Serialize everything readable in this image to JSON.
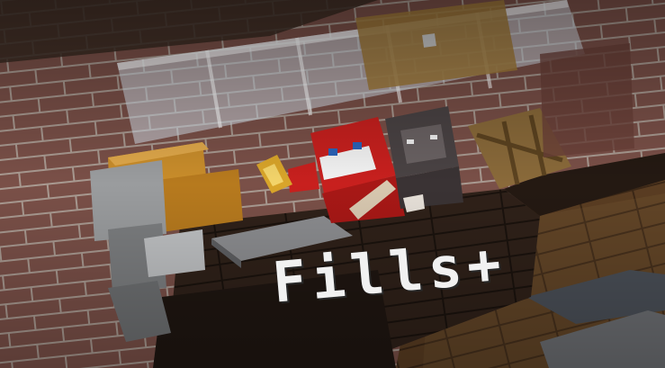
{
  "title": "Fills+",
  "colors": {
    "brick": "#7a5048",
    "mortar": "#a99a91",
    "wood_dark": "#2f2119",
    "wood_light": "#6b4a2b",
    "glass": "#d9e4ee",
    "red_player": "#c8201e",
    "gray_player": "#4a4344",
    "hay": "#c98d2b"
  }
}
